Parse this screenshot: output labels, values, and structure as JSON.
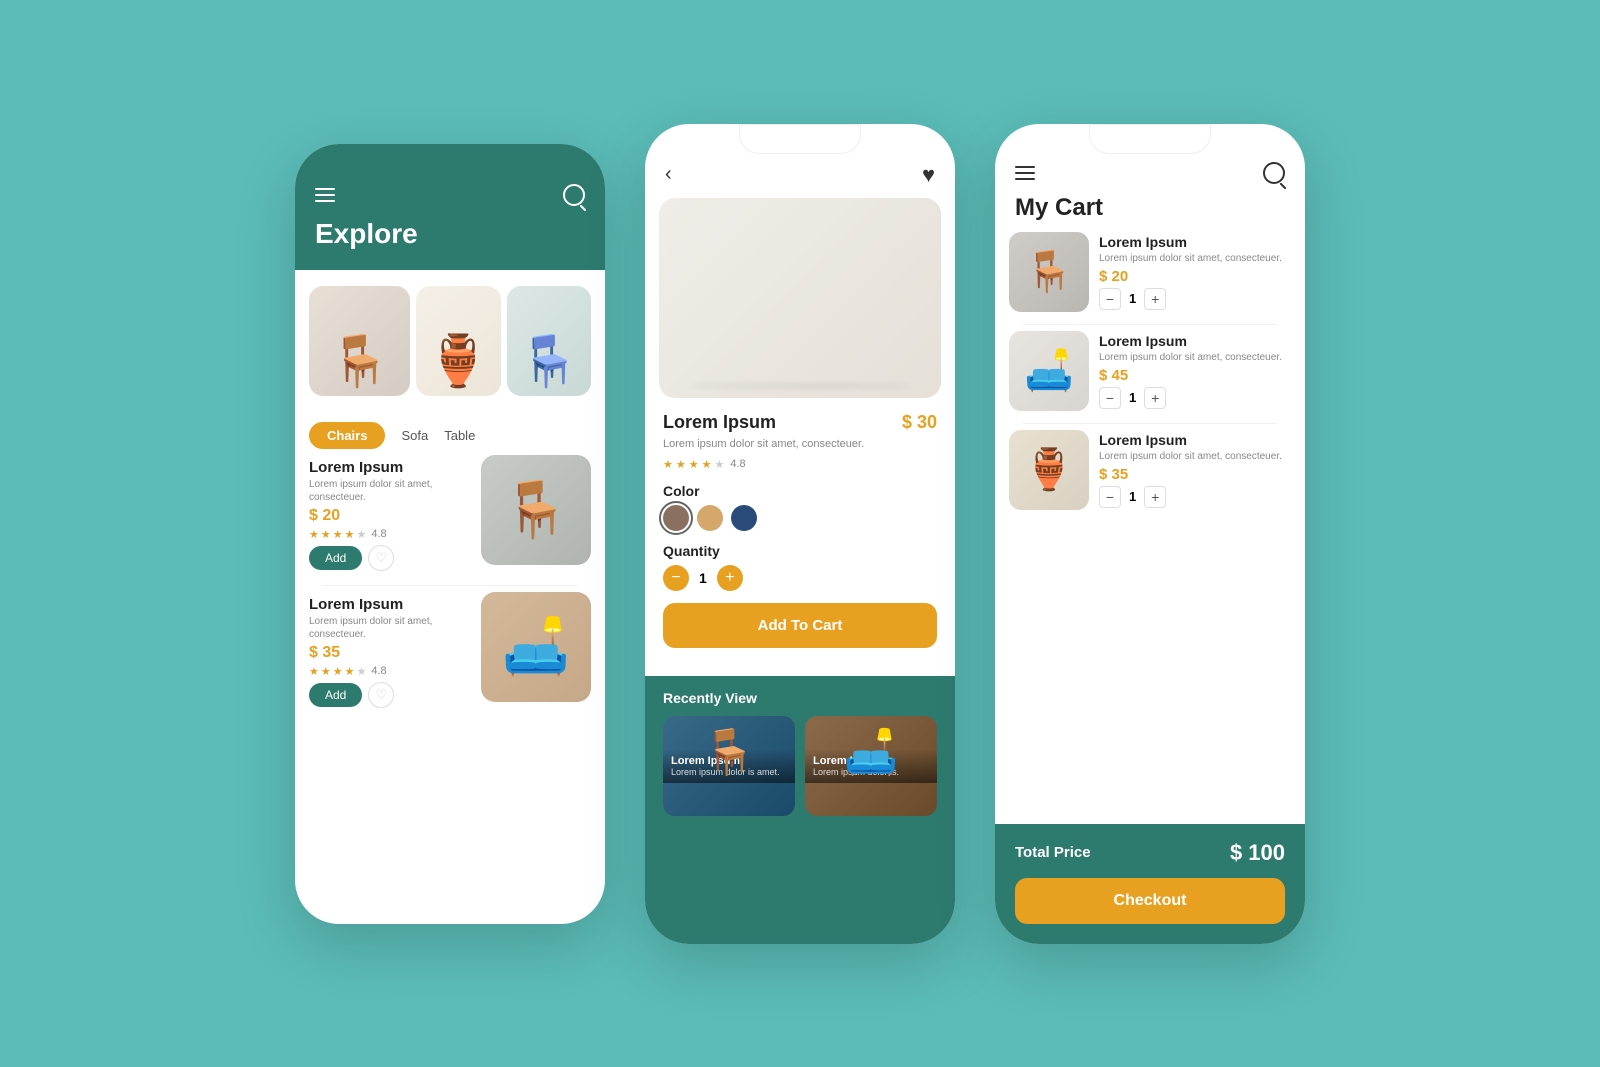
{
  "app": {
    "bg_color": "#5bbcb8",
    "accent_color": "#e8a020",
    "primary_color": "#2d7a6e"
  },
  "phone1": {
    "header": {
      "title": "Explore"
    },
    "categories": [
      {
        "label": "Chairs",
        "active": true
      },
      {
        "label": "Sofa",
        "active": false
      },
      {
        "label": "Table",
        "active": false
      }
    ],
    "products": [
      {
        "name": "Lorem Ipsum",
        "desc": "Lorem ipsum dolor sit amet, consecteuer.",
        "price": "$ 20",
        "rating": "4.8",
        "stars": 4
      },
      {
        "name": "Lorem Ipsum",
        "desc": "Lorem ipsum dolor sit amet, consecteuer.",
        "price": "$ 35",
        "rating": "4.8",
        "stars": 4
      }
    ],
    "add_label": "Add"
  },
  "phone2": {
    "product": {
      "name": "Lorem Ipsum",
      "desc": "Lorem ipsum dolor sit amet, consecteuer.",
      "price": "$ 30",
      "rating": "4.8",
      "stars": 4,
      "quantity": 1
    },
    "color_label": "Color",
    "quantity_label": "Quantity",
    "colors": [
      {
        "name": "brown",
        "hex": "#8a7060"
      },
      {
        "name": "tan",
        "hex": "#d4a86a"
      },
      {
        "name": "navy",
        "hex": "#2a4a7a"
      }
    ],
    "add_to_cart_label": "Add To Cart",
    "recently_view_label": "Recently View",
    "recently_items": [
      {
        "name": "Lorem Ipsum",
        "desc": "Lorem ipsum dolor is amet."
      },
      {
        "name": "Lorem Ipsum",
        "desc": "Lorem ipsum dolor is."
      }
    ]
  },
  "phone3": {
    "title": "My Cart",
    "cart_items": [
      {
        "name": "Lorem Ipsum",
        "desc": "Lorem ipsum dolor sit amet, consecteuer.",
        "price": "$ 20",
        "quantity": 1
      },
      {
        "name": "Lorem Ipsum",
        "desc": "Lorem ipsum dolor sit amet, consecteuer.",
        "price": "$ 45",
        "quantity": 1
      },
      {
        "name": "Lorem Ipsum",
        "desc": "Lorem ipsum dolor sit amet, consecteuer.",
        "price": "$ 35",
        "quantity": 1
      }
    ],
    "total_label": "Total Price",
    "total_amount": "$ 100",
    "checkout_label": "Checkout"
  }
}
